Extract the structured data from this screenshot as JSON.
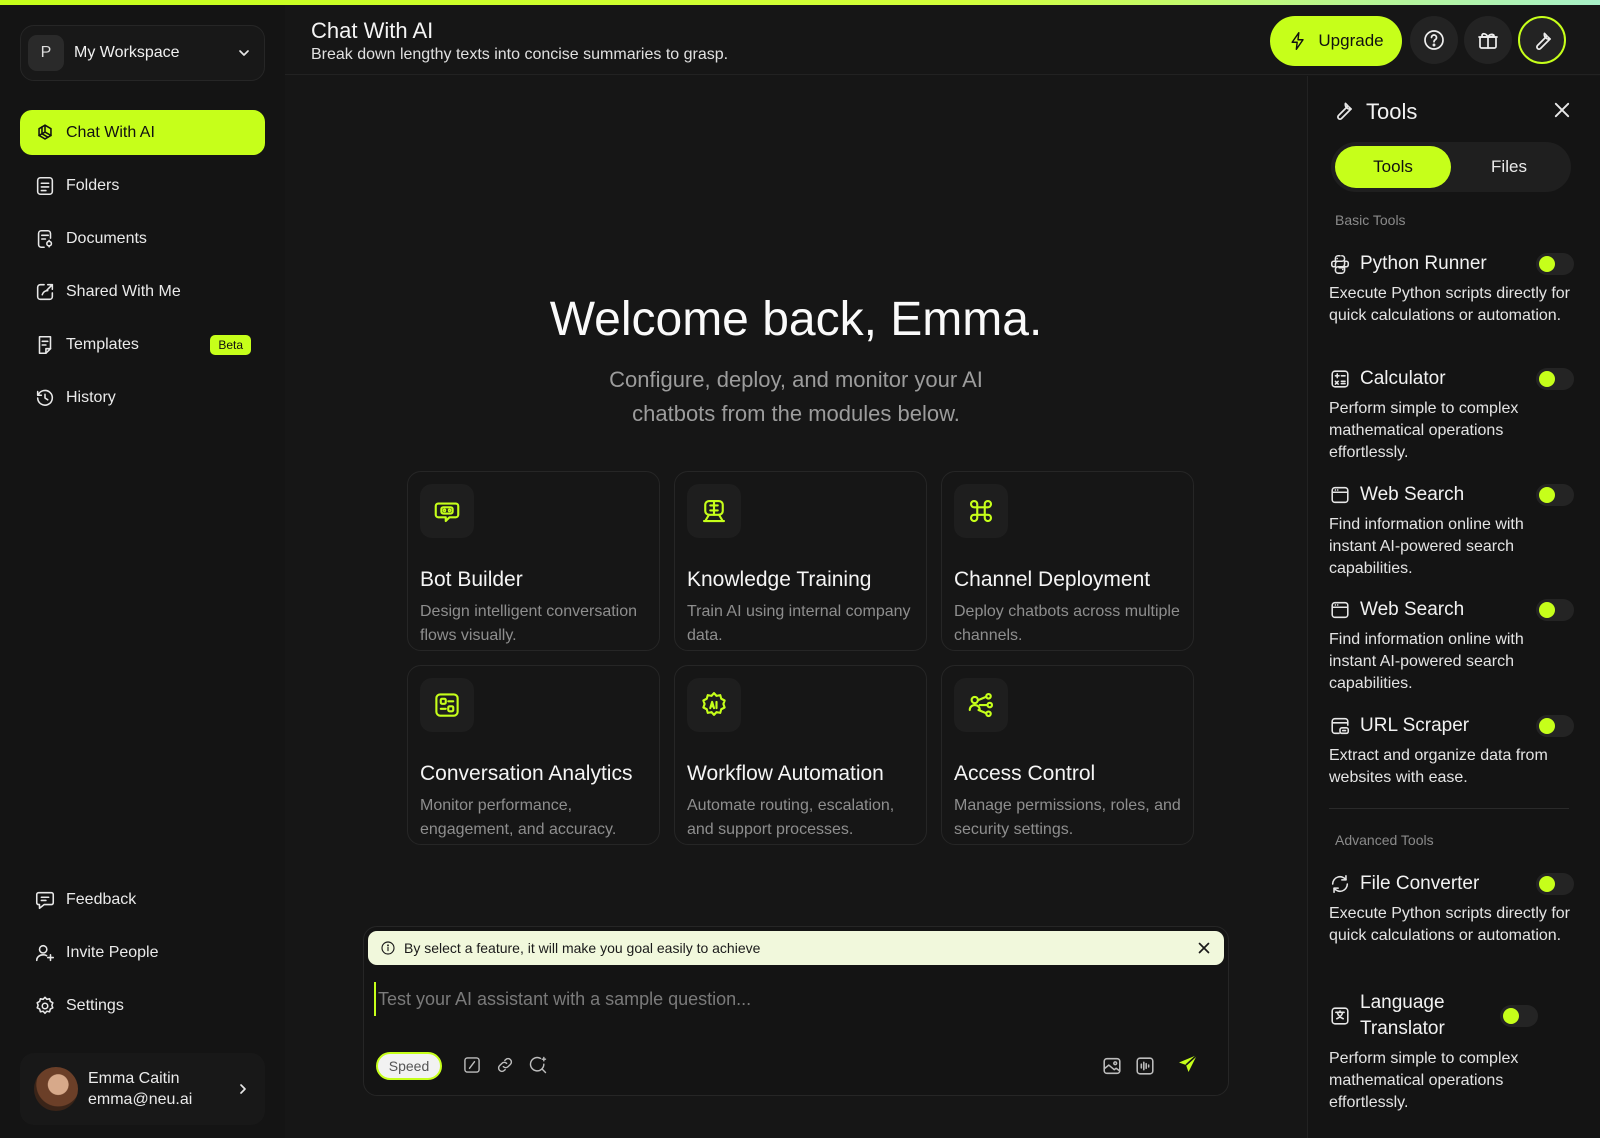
{
  "workspace": {
    "initial": "P",
    "name": "My Workspace"
  },
  "nav": {
    "items": [
      {
        "label": "Chat With AI",
        "icon": "openai-icon",
        "active": true
      },
      {
        "label": "Folders",
        "icon": "folder-icon"
      },
      {
        "label": "Documents",
        "icon": "document-icon"
      },
      {
        "label": "Shared With Me",
        "icon": "share-icon"
      },
      {
        "label": "Templates",
        "icon": "template-icon",
        "badge": "Beta"
      },
      {
        "label": "History",
        "icon": "history-icon"
      }
    ],
    "bottom": [
      {
        "label": "Feedback",
        "icon": "feedback-icon"
      },
      {
        "label": "Invite People",
        "icon": "invite-icon"
      },
      {
        "label": "Settings",
        "icon": "gear-icon"
      }
    ]
  },
  "user": {
    "name": "Emma Caitin",
    "email": "emma@neu.ai"
  },
  "header": {
    "title": "Chat With AI",
    "subtitle": "Break down lengthy texts into concise summaries to grasp.",
    "upgrade_label": "Upgrade"
  },
  "main": {
    "welcome": "Welcome back, Emma.",
    "welcome_sub": "Configure, deploy, and monitor your AI chatbots from the modules below.",
    "cards": [
      {
        "title": "Bot Builder",
        "desc": "Design intelligent conversation flows visually.",
        "icon": "bot-icon"
      },
      {
        "title": "Knowledge Training",
        "desc": "Train AI using internal company data.",
        "icon": "brain-icon"
      },
      {
        "title": "Channel Deployment",
        "desc": "Deploy chatbots across multiple channels.",
        "icon": "command-icon"
      },
      {
        "title": "Conversation Analytics",
        "desc": "Monitor performance, engagement, and accuracy.",
        "icon": "analytics-icon"
      },
      {
        "title": "Workflow Automation",
        "desc": "Automate routing, escalation, and support processes.",
        "icon": "ai-gear-icon"
      },
      {
        "title": "Access Control",
        "desc": "Manage permissions, roles, and security settings.",
        "icon": "network-icon"
      }
    ]
  },
  "composer": {
    "notice": "By select a feature, it will make you goal easily to achieve",
    "placeholder": "Test your AI assistant with a sample question...",
    "speed_label": "Speed"
  },
  "tools": {
    "title": "Tools",
    "tabs": [
      "Tools",
      "Files"
    ],
    "active_tab": "Tools",
    "basic_label": "Basic Tools",
    "advanced_label": "Advanced Tools",
    "basic": [
      {
        "name": "Python Runner",
        "desc": "Execute Python scripts directly for quick calculations or automation.",
        "icon": "python-icon",
        "enabled": true
      },
      {
        "name": "Calculator",
        "desc": "Perform simple to complex mathematical operations effortlessly.",
        "icon": "calculator-icon",
        "enabled": true
      },
      {
        "name": "Web Search",
        "desc": "Find information online with instant AI-powered search capabilities.",
        "icon": "browser-icon",
        "enabled": true
      },
      {
        "name": "Web Search",
        "desc": "Find information online with instant AI-powered search capabilities.",
        "icon": "browser-icon",
        "enabled": true
      },
      {
        "name": "URL Scraper",
        "desc": "Extract and organize data from websites with ease.",
        "icon": "scraper-icon",
        "enabled": true
      }
    ],
    "advanced": [
      {
        "name": "File Converter",
        "desc": "Execute Python scripts directly for quick calculations or automation.",
        "icon": "refresh-icon",
        "enabled": true
      },
      {
        "name": "Language Translator",
        "desc": "Perform simple to complex mathematical operations effortlessly.",
        "icon": "translate-icon",
        "enabled": true
      }
    ]
  },
  "colors": {
    "accent": "#c6ff1a",
    "background": "#161616",
    "panel": "#141414"
  }
}
